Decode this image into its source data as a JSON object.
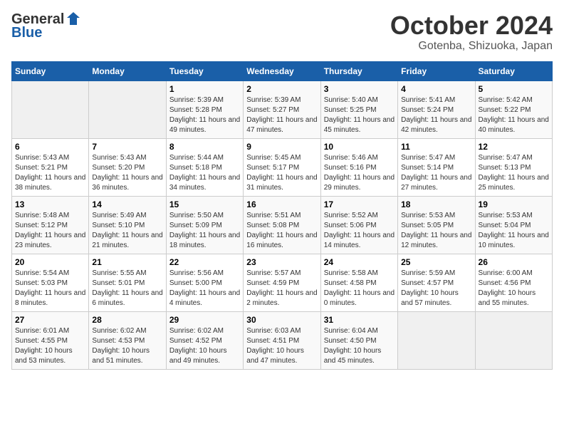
{
  "logo": {
    "general": "General",
    "blue": "Blue"
  },
  "title": "October 2024",
  "location": "Gotenba, Shizuoka, Japan",
  "days_header": [
    "Sunday",
    "Monday",
    "Tuesday",
    "Wednesday",
    "Thursday",
    "Friday",
    "Saturday"
  ],
  "weeks": [
    [
      {
        "num": "",
        "sunrise": "",
        "sunset": "",
        "daylight": ""
      },
      {
        "num": "",
        "sunrise": "",
        "sunset": "",
        "daylight": ""
      },
      {
        "num": "1",
        "sunrise": "Sunrise: 5:39 AM",
        "sunset": "Sunset: 5:28 PM",
        "daylight": "Daylight: 11 hours and 49 minutes."
      },
      {
        "num": "2",
        "sunrise": "Sunrise: 5:39 AM",
        "sunset": "Sunset: 5:27 PM",
        "daylight": "Daylight: 11 hours and 47 minutes."
      },
      {
        "num": "3",
        "sunrise": "Sunrise: 5:40 AM",
        "sunset": "Sunset: 5:25 PM",
        "daylight": "Daylight: 11 hours and 45 minutes."
      },
      {
        "num": "4",
        "sunrise": "Sunrise: 5:41 AM",
        "sunset": "Sunset: 5:24 PM",
        "daylight": "Daylight: 11 hours and 42 minutes."
      },
      {
        "num": "5",
        "sunrise": "Sunrise: 5:42 AM",
        "sunset": "Sunset: 5:22 PM",
        "daylight": "Daylight: 11 hours and 40 minutes."
      }
    ],
    [
      {
        "num": "6",
        "sunrise": "Sunrise: 5:43 AM",
        "sunset": "Sunset: 5:21 PM",
        "daylight": "Daylight: 11 hours and 38 minutes."
      },
      {
        "num": "7",
        "sunrise": "Sunrise: 5:43 AM",
        "sunset": "Sunset: 5:20 PM",
        "daylight": "Daylight: 11 hours and 36 minutes."
      },
      {
        "num": "8",
        "sunrise": "Sunrise: 5:44 AM",
        "sunset": "Sunset: 5:18 PM",
        "daylight": "Daylight: 11 hours and 34 minutes."
      },
      {
        "num": "9",
        "sunrise": "Sunrise: 5:45 AM",
        "sunset": "Sunset: 5:17 PM",
        "daylight": "Daylight: 11 hours and 31 minutes."
      },
      {
        "num": "10",
        "sunrise": "Sunrise: 5:46 AM",
        "sunset": "Sunset: 5:16 PM",
        "daylight": "Daylight: 11 hours and 29 minutes."
      },
      {
        "num": "11",
        "sunrise": "Sunrise: 5:47 AM",
        "sunset": "Sunset: 5:14 PM",
        "daylight": "Daylight: 11 hours and 27 minutes."
      },
      {
        "num": "12",
        "sunrise": "Sunrise: 5:47 AM",
        "sunset": "Sunset: 5:13 PM",
        "daylight": "Daylight: 11 hours and 25 minutes."
      }
    ],
    [
      {
        "num": "13",
        "sunrise": "Sunrise: 5:48 AM",
        "sunset": "Sunset: 5:12 PM",
        "daylight": "Daylight: 11 hours and 23 minutes."
      },
      {
        "num": "14",
        "sunrise": "Sunrise: 5:49 AM",
        "sunset": "Sunset: 5:10 PM",
        "daylight": "Daylight: 11 hours and 21 minutes."
      },
      {
        "num": "15",
        "sunrise": "Sunrise: 5:50 AM",
        "sunset": "Sunset: 5:09 PM",
        "daylight": "Daylight: 11 hours and 18 minutes."
      },
      {
        "num": "16",
        "sunrise": "Sunrise: 5:51 AM",
        "sunset": "Sunset: 5:08 PM",
        "daylight": "Daylight: 11 hours and 16 minutes."
      },
      {
        "num": "17",
        "sunrise": "Sunrise: 5:52 AM",
        "sunset": "Sunset: 5:06 PM",
        "daylight": "Daylight: 11 hours and 14 minutes."
      },
      {
        "num": "18",
        "sunrise": "Sunrise: 5:53 AM",
        "sunset": "Sunset: 5:05 PM",
        "daylight": "Daylight: 11 hours and 12 minutes."
      },
      {
        "num": "19",
        "sunrise": "Sunrise: 5:53 AM",
        "sunset": "Sunset: 5:04 PM",
        "daylight": "Daylight: 11 hours and 10 minutes."
      }
    ],
    [
      {
        "num": "20",
        "sunrise": "Sunrise: 5:54 AM",
        "sunset": "Sunset: 5:03 PM",
        "daylight": "Daylight: 11 hours and 8 minutes."
      },
      {
        "num": "21",
        "sunrise": "Sunrise: 5:55 AM",
        "sunset": "Sunset: 5:01 PM",
        "daylight": "Daylight: 11 hours and 6 minutes."
      },
      {
        "num": "22",
        "sunrise": "Sunrise: 5:56 AM",
        "sunset": "Sunset: 5:00 PM",
        "daylight": "Daylight: 11 hours and 4 minutes."
      },
      {
        "num": "23",
        "sunrise": "Sunrise: 5:57 AM",
        "sunset": "Sunset: 4:59 PM",
        "daylight": "Daylight: 11 hours and 2 minutes."
      },
      {
        "num": "24",
        "sunrise": "Sunrise: 5:58 AM",
        "sunset": "Sunset: 4:58 PM",
        "daylight": "Daylight: 11 hours and 0 minutes."
      },
      {
        "num": "25",
        "sunrise": "Sunrise: 5:59 AM",
        "sunset": "Sunset: 4:57 PM",
        "daylight": "Daylight: 10 hours and 57 minutes."
      },
      {
        "num": "26",
        "sunrise": "Sunrise: 6:00 AM",
        "sunset": "Sunset: 4:56 PM",
        "daylight": "Daylight: 10 hours and 55 minutes."
      }
    ],
    [
      {
        "num": "27",
        "sunrise": "Sunrise: 6:01 AM",
        "sunset": "Sunset: 4:55 PM",
        "daylight": "Daylight: 10 hours and 53 minutes."
      },
      {
        "num": "28",
        "sunrise": "Sunrise: 6:02 AM",
        "sunset": "Sunset: 4:53 PM",
        "daylight": "Daylight: 10 hours and 51 minutes."
      },
      {
        "num": "29",
        "sunrise": "Sunrise: 6:02 AM",
        "sunset": "Sunset: 4:52 PM",
        "daylight": "Daylight: 10 hours and 49 minutes."
      },
      {
        "num": "30",
        "sunrise": "Sunrise: 6:03 AM",
        "sunset": "Sunset: 4:51 PM",
        "daylight": "Daylight: 10 hours and 47 minutes."
      },
      {
        "num": "31",
        "sunrise": "Sunrise: 6:04 AM",
        "sunset": "Sunset: 4:50 PM",
        "daylight": "Daylight: 10 hours and 45 minutes."
      },
      {
        "num": "",
        "sunrise": "",
        "sunset": "",
        "daylight": ""
      },
      {
        "num": "",
        "sunrise": "",
        "sunset": "",
        "daylight": ""
      }
    ]
  ]
}
